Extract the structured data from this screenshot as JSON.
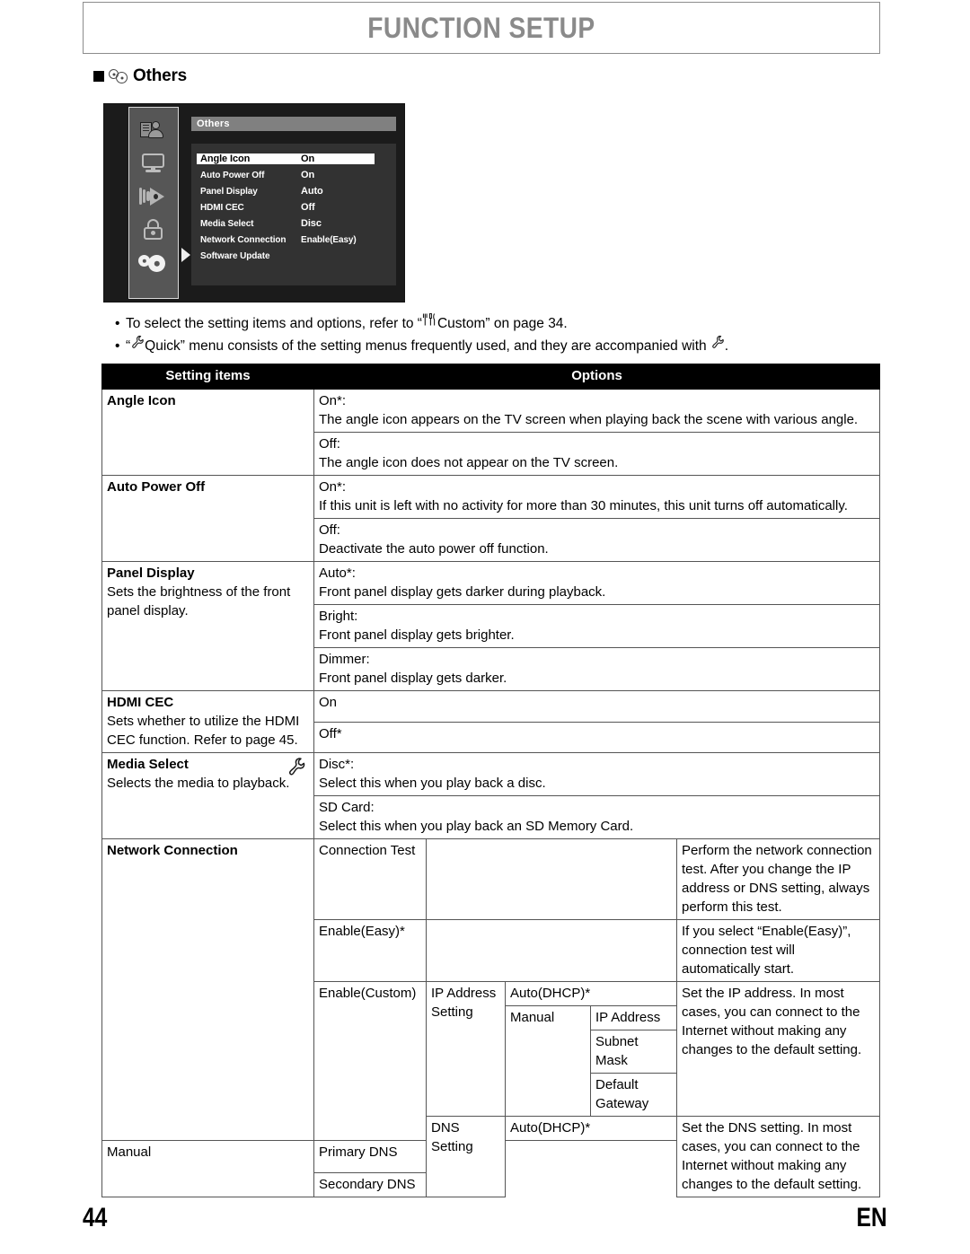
{
  "header": {
    "title": "FUNCTION SETUP"
  },
  "section": {
    "label": "Others",
    "icon": "gears-icon"
  },
  "osd": {
    "title": "Others",
    "sidebar_icons": [
      "media-person-icon",
      "display-icon",
      "audio-icon",
      "lock-icon",
      "gears-icon"
    ],
    "rows": [
      {
        "name": "Angle Icon",
        "value": "On",
        "selected": true
      },
      {
        "name": "Auto Power Off",
        "value": "On",
        "selected": false
      },
      {
        "name": "Panel Display",
        "value": "Auto",
        "selected": false
      },
      {
        "name": "HDMI CEC",
        "value": "Off",
        "selected": false
      },
      {
        "name": "Media Select",
        "value": "Disc",
        "selected": false
      },
      {
        "name": "Network Connection",
        "value": "Enable(Easy)",
        "selected": false
      },
      {
        "name": "Software Update",
        "value": "",
        "selected": false
      }
    ]
  },
  "notes": {
    "line1_a": "To select the setting items and options, refer to “",
    "line1_icon": "custom-icon",
    "line1_b": "Custom” on page 34.",
    "line2_a": "“",
    "line2_icon": "quick-icon",
    "line2_b": "Quick”  menu consists of the setting menus frequently used, and they are accompanied with",
    "line2_icon2": "quick-icon",
    "line2_c": "."
  },
  "table": {
    "headers": {
      "col1": "Setting items",
      "col2": "Options"
    },
    "rows": {
      "angle_icon": {
        "item": "Angle Icon",
        "opt1_title": "On*:",
        "opt1_desc": "The angle icon appears on the TV screen when playing back the scene with various angle.",
        "opt2_title": "Off:",
        "opt2_desc": "The angle icon does not appear on the TV screen."
      },
      "auto_power_off": {
        "item": "Auto Power Off",
        "opt1_title": "On*:",
        "opt1_desc": "If this unit is left with no activity for more than 30 minutes, this unit turns off automatically.",
        "opt2_title": "Off:",
        "opt2_desc": "Deactivate the auto power off function."
      },
      "panel_display": {
        "item": "Panel Display",
        "item_sub": "Sets the brightness of the front panel display.",
        "opt1_title": "Auto*:",
        "opt1_desc": "Front panel display gets darker during playback.",
        "opt2_title": "Bright:",
        "opt2_desc": "Front panel display gets brighter.",
        "opt3_title": "Dimmer:",
        "opt3_desc": "Front panel display gets darker."
      },
      "hdmi_cec": {
        "item": "HDMI CEC",
        "item_sub": "Sets whether to utilize the HDMI CEC function. Refer to page 45.",
        "opt1": "On",
        "opt2": "Off*"
      },
      "media_select": {
        "item": "Media Select",
        "item_sub": "Selects the media to playback.",
        "icon": "quick-icon",
        "opt1_title": "Disc*:",
        "opt1_desc": "Select this when you play back a disc.",
        "opt2_title": "SD Card:",
        "opt2_desc": "Select this when you play back an SD Memory Card."
      },
      "network_connection": {
        "item": "Network Connection",
        "conn_test": "Connection Test",
        "conn_test_desc": "Perform the network connection test. After you change the IP address or DNS setting, always perform this test.",
        "enable_easy": "Enable(Easy)*",
        "enable_easy_desc": "If you select “Enable(Easy)”, connection test will automatically start.",
        "enable_custom": "Enable(Custom)",
        "ip_setting": "IP Address Setting",
        "ip_auto": "Auto(DHCP)*",
        "ip_manual": "Manual",
        "ip_sub1": "IP Address",
        "ip_sub2": "Subnet Mask",
        "ip_sub3": "Default Gateway",
        "ip_desc": "Set the IP address. In most cases, you can connect to the Internet without making any changes to the default setting.",
        "dns_setting": "DNS Setting",
        "dns_auto": "Auto(DHCP)*",
        "dns_manual": "Manual",
        "dns_sub1": "Primary DNS",
        "dns_sub2": "Secondary DNS",
        "dns_desc": "Set the DNS setting. In most cases, you can connect to the Internet without making any changes to the default setting."
      }
    }
  },
  "footer": {
    "page": "44",
    "lang": "EN"
  }
}
